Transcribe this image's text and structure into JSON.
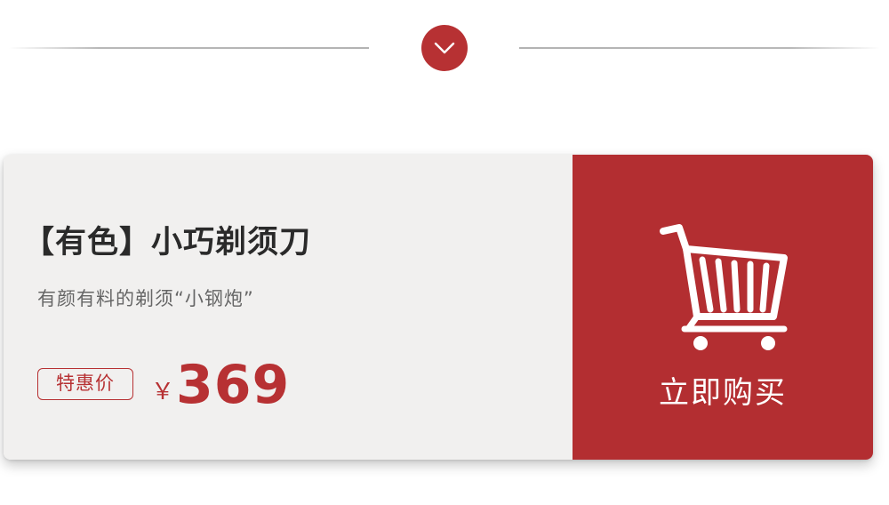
{
  "divider": {
    "icon": "chevron-down-icon"
  },
  "product": {
    "title": "【有色】小巧剃须刀",
    "subtitle": "有颜有料的剃须“小钢炮”",
    "price_tag": "特惠价",
    "currency": "￥",
    "price": "369"
  },
  "buy": {
    "icon": "shopping-cart-icon",
    "label": "立即购买"
  },
  "colors": {
    "accent": "#b73133",
    "card_bg": "#f1f0ef",
    "title_text": "#2a2a2a",
    "subtitle_text": "#666666"
  }
}
